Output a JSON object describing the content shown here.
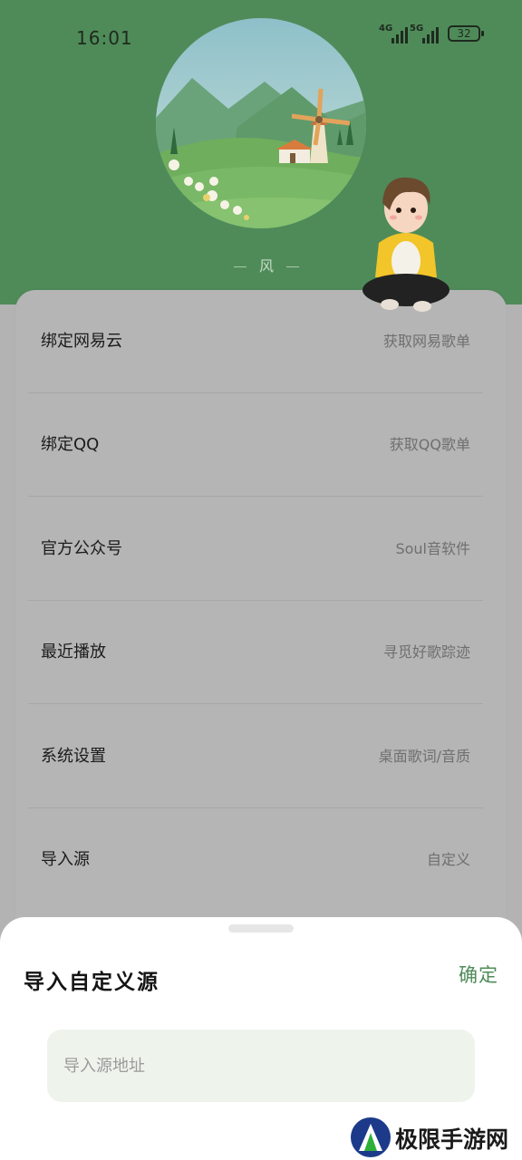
{
  "status_bar": {
    "time": "16:01",
    "net1": "4G",
    "net2": "5G",
    "battery": "32"
  },
  "cover": {
    "label": "风"
  },
  "settings": {
    "items": [
      {
        "title": "绑定网易云",
        "subtitle": "获取网易歌单"
      },
      {
        "title": "绑定QQ",
        "subtitle": "获取QQ歌单"
      },
      {
        "title": "官方公众号",
        "subtitle": "Soul音软件"
      },
      {
        "title": "最近播放",
        "subtitle": "寻觅好歌踪迹"
      },
      {
        "title": "系统设置",
        "subtitle": "桌面歌词/音质"
      },
      {
        "title": "导入源",
        "subtitle": "自定义"
      }
    ]
  },
  "sheet": {
    "title": "导入自定义源",
    "confirm": "确定",
    "input_placeholder": "导入源地址",
    "input_value": ""
  },
  "watermark": {
    "text": "极限手游网"
  },
  "colors": {
    "header_green": "#4f8b59",
    "accent_green": "#4f8b59",
    "overlay_gray": "#b3b3b3"
  }
}
